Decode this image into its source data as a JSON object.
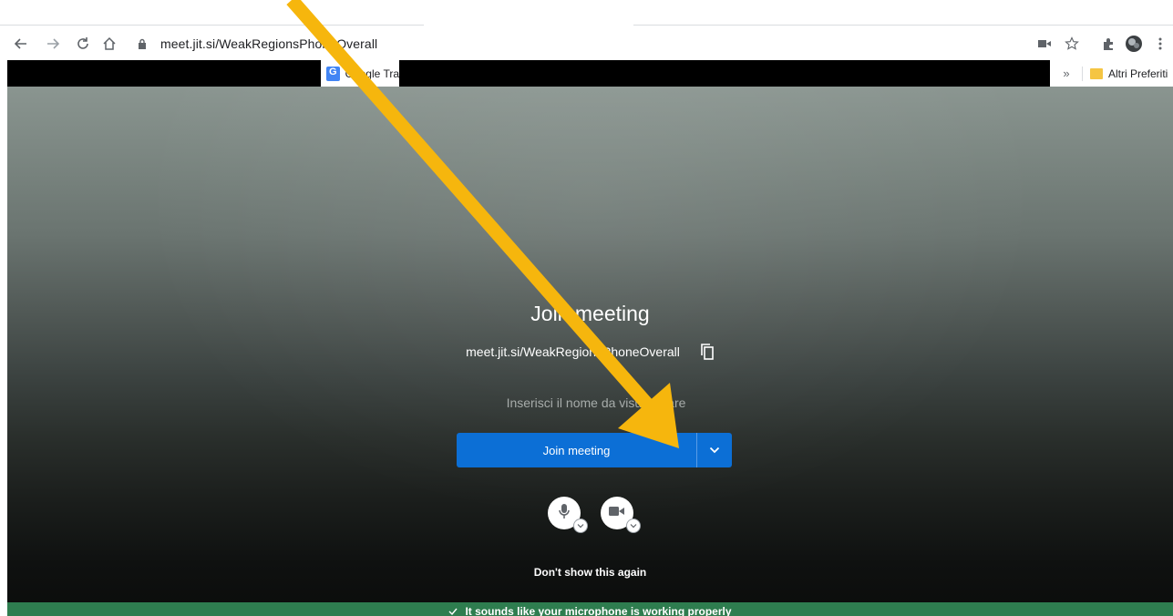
{
  "browser": {
    "url": "meet.jit.si/WeakRegionsPhoneOverall",
    "bookmarks": {
      "google_item": "Google Tra",
      "more": "»",
      "folder": "Altri Preferiti"
    }
  },
  "meeting": {
    "title": "Join meeting",
    "room_url": "meet.jit.si/WeakRegionsPhoneOverall",
    "name_placeholder": "Inserisci il nome da visualizzare",
    "join_button": "Join meeting",
    "dont_show": "Don't show this again",
    "mic_status": "It sounds like your microphone is working properly"
  },
  "colors": {
    "join_button": "#0c6fd6",
    "banner": "#2e7d4f",
    "annotation_arrow": "#f6b60d"
  },
  "icons": [
    "back-icon",
    "forward-icon",
    "reload-icon",
    "home-icon",
    "lock-icon",
    "camera-status-icon",
    "star-icon",
    "extensions-icon",
    "profile-avatar-icon",
    "menu-icon",
    "copy-icon",
    "chevron-down-icon",
    "microphone-icon",
    "video-camera-icon",
    "check-icon",
    "folder-icon"
  ]
}
